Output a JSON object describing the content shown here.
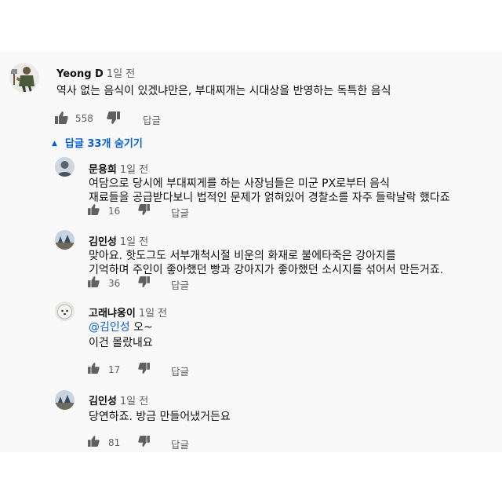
{
  "thread": {
    "main": {
      "author": "Yeong D",
      "time": "1일 전",
      "text": "역사 없는 음식이 있겠냐만은, 부대찌개는 시대상을 반영하는 독특한 음식",
      "likes": "558",
      "reply_label": "답글"
    },
    "replies_toggle": {
      "arrow": "▲",
      "label": "답글 33개 숨기기"
    },
    "replies": [
      {
        "author": "문용희",
        "time": "1일 전",
        "lines": [
          "여담으로 당시에 부대찌게를 하는 사장님들은 미군 PX로부터 음식",
          "재료들을 공급받다보니 법적인 문제가 얽혀있어 경찰소를 자주 들락날락 했다죠"
        ],
        "likes": "16",
        "reply_label": "답글"
      },
      {
        "author": "김인성",
        "time": "1일 전",
        "lines": [
          "맞아요. 핫도그도 서부개척시절 비운의 화재로 불에타죽은 강아지를",
          "기억하며 주인이 좋아했던 빵과 강아지가 좋아했던 소시지를 섞어서 만든거죠."
        ],
        "likes": "36",
        "reply_label": "답글"
      },
      {
        "author": "고래냐옹이",
        "time": "1일 전",
        "mention": "@김인성",
        "mention_rest": " 오~",
        "line2": "이건 몰랐내요",
        "likes": "17",
        "reply_label": "답글"
      },
      {
        "author": "김인성",
        "time": "1일 전",
        "lines": [
          "당연하죠. 방금 만들어냈거든요"
        ],
        "likes": "81",
        "reply_label": "답글"
      }
    ]
  },
  "colors": {
    "link": "#065fd4",
    "panel": "#f9f9f9",
    "muted": "#606060"
  },
  "icons": [
    "like-icon",
    "dislike-icon",
    "chevron-up-icon"
  ]
}
